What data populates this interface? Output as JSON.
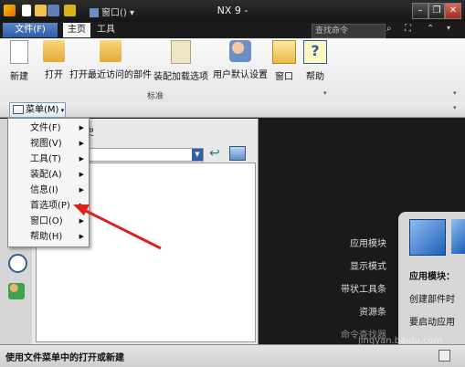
{
  "window": {
    "title": "NX 9 -",
    "quick_access_window": "窗口()",
    "search_placeholder": "查找命令"
  },
  "tabs": {
    "file": "文件(F)",
    "home": "主页",
    "tools": "工具"
  },
  "ribbon": {
    "buttons": [
      "新建",
      "打开",
      "打开最近访问的部件",
      "装配加载选项",
      "用户默认设置",
      "窗口",
      "帮助"
    ],
    "group_label": "标准"
  },
  "menubar": {
    "menu_label": "菜单(M)"
  },
  "dropdown": {
    "items": [
      "文件(F)",
      "视图(V)",
      "工具(T)",
      "装配(A)",
      "信息(I)",
      "首选项(P)",
      "窗口(O)",
      "帮助(H)"
    ]
  },
  "navpanel": {
    "header": "史"
  },
  "graphics": {
    "menu_items": [
      "应用模块",
      "显示模式",
      "带状工具条",
      "资源条",
      "命令查找器"
    ]
  },
  "resource_panel": {
    "lines": [
      "应用模块：",
      "创建部件时",
      "要启动应用"
    ]
  },
  "status": {
    "text": "使用文件菜单中的打开或新建"
  },
  "watermark": "jingyan.baidu.com"
}
